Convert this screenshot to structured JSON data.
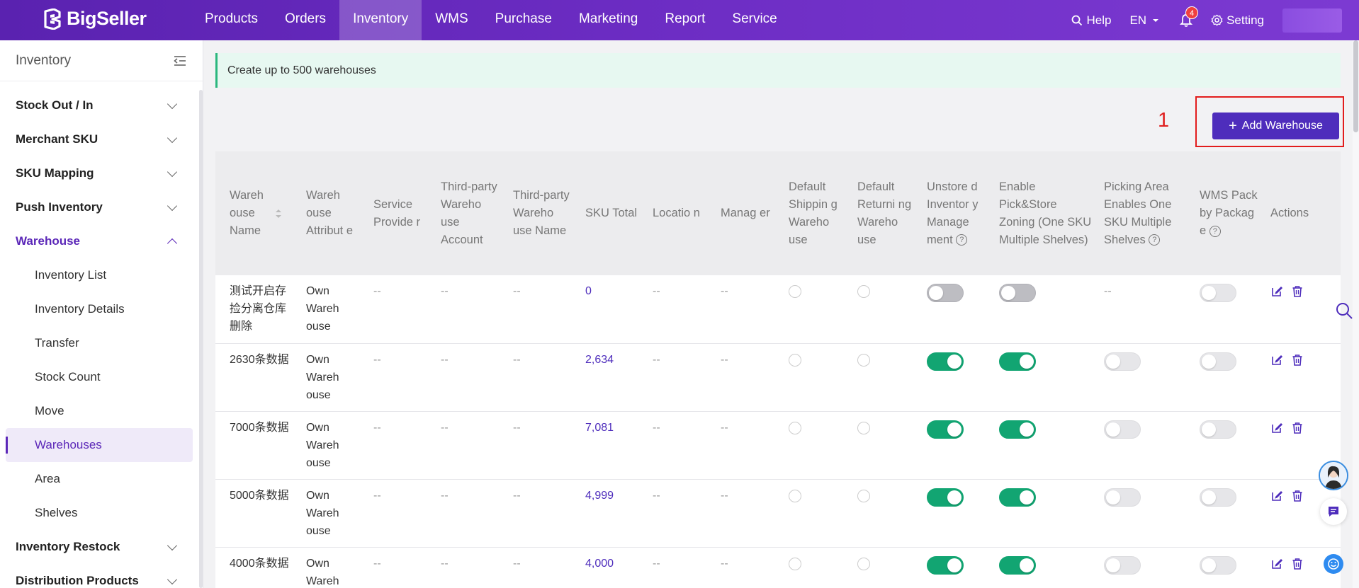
{
  "brand": {
    "name": "BigSeller"
  },
  "nav": {
    "items": [
      {
        "label": "Products",
        "active": false
      },
      {
        "label": "Orders",
        "active": false
      },
      {
        "label": "Inventory",
        "active": true
      },
      {
        "label": "WMS",
        "active": false
      },
      {
        "label": "Purchase",
        "active": false
      },
      {
        "label": "Marketing",
        "active": false
      },
      {
        "label": "Report",
        "active": false
      },
      {
        "label": "Service",
        "active": false
      }
    ],
    "help_label": "Help",
    "lang_label": "EN",
    "notif_count": "4",
    "setting_label": "Setting"
  },
  "sidebar": {
    "title": "Inventory",
    "groups_top": [
      "Stock Out / In",
      "Merchant SKU",
      "SKU Mapping",
      "Push Inventory"
    ],
    "open_group": "Warehouse",
    "sub_items": [
      "Inventory List",
      "Inventory Details",
      "Transfer",
      "Stock Count",
      "Move",
      "Warehouses",
      "Area",
      "Shelves"
    ],
    "active_sub": "Warehouses",
    "groups_bottom": [
      "Inventory Restock",
      "Distribution Products"
    ]
  },
  "notice": "Create up to 500 warehouses",
  "toolbar": {
    "step_number": "1",
    "add_label": "Add Warehouse"
  },
  "table": {
    "headers": {
      "name": "Wareh ouse Name",
      "attribute": "Wareh ouse Attribut e",
      "provider": "Service Provide r",
      "tp_account": "Third-party Wareho use Account",
      "tp_name": "Third-party Wareho use Name",
      "sku_total": "SKU Total",
      "location": "Locatio n",
      "manager": "Manag er",
      "default_shipping": "Default Shippin g Wareho use",
      "default_returning": "Default Returni ng Wareho use",
      "unstored": "Unstore d Inventor y Manage ment",
      "pick_store": "Enable Pick&Store Zoning (One SKU Multiple Shelves)",
      "picking_area": "Picking Area Enables One SKU Multiple Shelves",
      "wms_pack": "WMS Pack by Packag e",
      "actions": "Actions"
    },
    "rows": [
      {
        "name": "测试开启存捡分离仓库删除",
        "attribute": "Own Wareh ouse",
        "provider": "--",
        "tp_account": "--",
        "tp_name": "--",
        "sku_total": "0",
        "location": "--",
        "manager": "--",
        "unstored": false,
        "pick_store": false,
        "picking_area": "--",
        "wms_pack": false
      },
      {
        "name": "2630条数据",
        "attribute": "Own Wareh ouse",
        "provider": "--",
        "tp_account": "--",
        "tp_name": "--",
        "sku_total": "2,634",
        "location": "--",
        "manager": "--",
        "unstored": true,
        "pick_store": true,
        "picking_area": "off",
        "wms_pack": false
      },
      {
        "name": "7000条数据",
        "attribute": "Own Wareh ouse",
        "provider": "--",
        "tp_account": "--",
        "tp_name": "--",
        "sku_total": "7,081",
        "location": "--",
        "manager": "--",
        "unstored": true,
        "pick_store": true,
        "picking_area": "off",
        "wms_pack": false
      },
      {
        "name": "5000条数据",
        "attribute": "Own Wareh ouse",
        "provider": "--",
        "tp_account": "--",
        "tp_name": "--",
        "sku_total": "4,999",
        "location": "--",
        "manager": "--",
        "unstored": true,
        "pick_store": true,
        "picking_area": "off",
        "wms_pack": false
      },
      {
        "name": "4000条数据",
        "attribute": "Own Wareh ouse",
        "provider": "--",
        "tp_account": "--",
        "tp_name": "--",
        "sku_total": "4,000",
        "location": "--",
        "manager": "--",
        "unstored": true,
        "pick_store": true,
        "picking_area": "off",
        "wms_pack": false
      }
    ]
  },
  "colors": {
    "brand": "#5a22b0",
    "accent": "#4e2dbc",
    "toggle_on": "#12a572",
    "highlight": "#e21c1c"
  }
}
